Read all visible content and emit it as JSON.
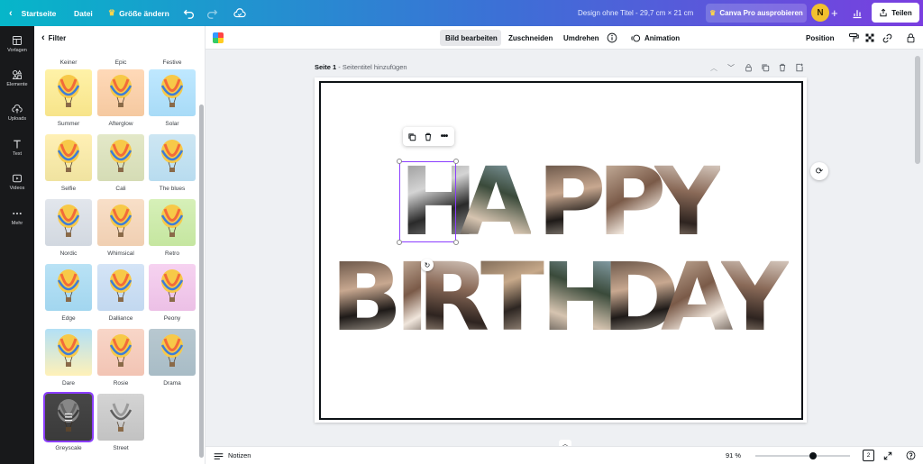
{
  "topbar": {
    "home": "Startseite",
    "file": "Datei",
    "resize": "Größe ändern",
    "design_title": "Design ohne Titel - 29,7 cm × 21 cm",
    "pro_button": "Canva Pro ausprobieren",
    "avatar_initial": "N",
    "share": "Teilen"
  },
  "rail": {
    "items": [
      {
        "label": "Vorlagen",
        "icon": "templates-icon"
      },
      {
        "label": "Elemente",
        "icon": "elements-icon"
      },
      {
        "label": "Uploads",
        "icon": "upload-icon"
      },
      {
        "label": "Text",
        "icon": "text-icon"
      },
      {
        "label": "Videos",
        "icon": "video-icon"
      },
      {
        "label": "Mehr",
        "icon": "more-icon"
      }
    ]
  },
  "panel": {
    "back_label": "Filter",
    "top_labels": [
      "Keiner",
      "Epic",
      "Festive"
    ],
    "filters": [
      {
        "name": "Summer",
        "sky": "#fff2a8",
        "tint": "#f7e48a"
      },
      {
        "name": "Afterglow",
        "sky": "#ffd9b8",
        "tint": "#f5c9a0"
      },
      {
        "name": "Solar",
        "sky": "#bfe8ff",
        "tint": "#a8dbf7"
      },
      {
        "name": "Selfie",
        "sky": "#fff0b5",
        "tint": "#f0e3a0"
      },
      {
        "name": "Cali",
        "sky": "#e3e8c8",
        "tint": "#d5dcb5"
      },
      {
        "name": "The blues",
        "sky": "#cde6f3",
        "tint": "#b8dcef"
      },
      {
        "name": "Nordic",
        "sky": "#e2e6ec",
        "tint": "#d2d8e0"
      },
      {
        "name": "Whimsical",
        "sky": "#f8dfc8",
        "tint": "#f0cfb2"
      },
      {
        "name": "Retro",
        "sky": "#d6f0b8",
        "tint": "#c5e6a0"
      },
      {
        "name": "Edge",
        "sky": "#b9e2f5",
        "tint": "#a2d6ef"
      },
      {
        "name": "Dalliance",
        "sky": "#d4e4f6",
        "tint": "#c2d8f0"
      },
      {
        "name": "Peony",
        "sky": "#f6d2f0",
        "tint": "#ecc0e6"
      },
      {
        "name": "Dare",
        "sky": "#b2e0f6",
        "tint": "#fff1b8"
      },
      {
        "name": "Rosie",
        "sky": "#f8d6c8",
        "tint": "#f2c4b4"
      },
      {
        "name": "Drama",
        "sky": "#b8c8d0",
        "tint": "#a8bcc6"
      },
      {
        "name": "Greyscale",
        "sky": "#6e6e6e",
        "tint": "#5a5a5a",
        "selected": true
      },
      {
        "name": "Street",
        "sky": "#d4d4d4",
        "tint": "#c2c2c2"
      }
    ]
  },
  "toolbar": {
    "edit_image": "Bild bearbeiten",
    "crop": "Zuschneiden",
    "flip": "Umdrehen",
    "animation": "Animation",
    "position": "Position"
  },
  "page": {
    "label_bold": "Seite 1",
    "label_rest": " - Seitentitel hinzufügen",
    "word1": [
      "H",
      "A",
      "P",
      "P",
      "Y"
    ],
    "word2": [
      "B",
      "I",
      "R",
      "T",
      "H",
      "D",
      "A",
      "Y"
    ]
  },
  "bottom": {
    "notes": "Notizen",
    "zoom": "91 %",
    "page_count": "2",
    "zoom_level": 0.61
  },
  "colors": {
    "accent": "#8b3dff"
  }
}
